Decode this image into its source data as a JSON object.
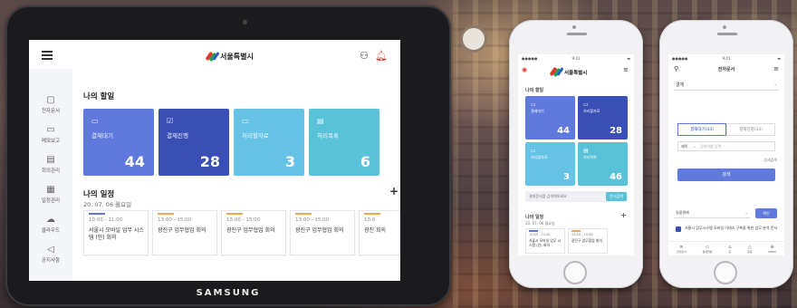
{
  "tablet": {
    "brand": "SAMSUNG",
    "logo_text": "서울특별시",
    "sidebar": [
      {
        "icon": "document-icon",
        "glyph": "▢",
        "label": "전자문서"
      },
      {
        "icon": "folder-icon",
        "glyph": "▭",
        "label": "메모보고"
      },
      {
        "icon": "list-icon",
        "glyph": "▤",
        "label": "회의관리"
      },
      {
        "icon": "calendar-icon",
        "glyph": "▦",
        "label": "일정관리"
      },
      {
        "icon": "cloud-icon",
        "glyph": "☁",
        "label": "클라우드"
      },
      {
        "icon": "megaphone-icon",
        "glyph": "◁",
        "label": "공지사항"
      }
    ],
    "tasks_title": "나의 할일",
    "cards": [
      {
        "label": "결재대기",
        "count": "44",
        "color": "#5f79dc"
      },
      {
        "label": "결재진행",
        "count": "28",
        "color": "#3a4fb6"
      },
      {
        "label": "처리할자료",
        "count": "3",
        "color": "#66c3e6"
      },
      {
        "label": "처리목록",
        "count": "6",
        "color": "#5ac2d8"
      }
    ],
    "schedule_title": "나의 일정",
    "schedule_date": "20. 07. 06 월요일",
    "schedule": [
      {
        "time": "10:00 - 11:00",
        "title": "서울시 모바일 업무 시스템 (안) 회의",
        "color": "#5f79dc"
      },
      {
        "time": "13:00 - 15:00",
        "title": "광진구 업무협업 회의",
        "color": "#f0a64a"
      },
      {
        "time": "13:00 - 15:00",
        "title": "광진구 업무협업 회의",
        "color": "#f0a64a"
      },
      {
        "time": "13:00 - 15:00",
        "title": "광진구 업무협업 회의",
        "color": "#f0a64a"
      },
      {
        "time": "13:0",
        "title": "광진 회의",
        "color": "#f0a64a"
      }
    ]
  },
  "phone1": {
    "logo_text": "서울특별시",
    "tasks_title": "나의 할일",
    "cards": [
      {
        "label": "결재대기",
        "count": "44",
        "color": "#5f79dc"
      },
      {
        "label": "처리할자료",
        "count": "28",
        "color": "#3a4fb6"
      },
      {
        "label": "처리할자료",
        "count": "3",
        "color": "#66c3e6"
      },
      {
        "label": "처리목록",
        "count": "46",
        "color": "#5ac2d8"
      }
    ],
    "search_placeholder": "결재문서를 검색해보세요",
    "search_button": "문서검색",
    "schedule_title": "나의 일정",
    "schedule_date": "20. 07. 06 월요일",
    "schedule": [
      {
        "time": "10:00 - 11:00",
        "title": "서울시 모바일 업무 시스템 (안) 회의"
      },
      {
        "time": "13:00 - 15:00",
        "title": "광진구 업무협업 회의"
      }
    ]
  },
  "phone2": {
    "title": "전자문서",
    "filter": "결재",
    "tab_active": "결재대기(43)",
    "tab_inactive": "결재진행(33)",
    "search_field_label": "제목",
    "search_field_placeholder": "검색어를 입력",
    "detail_search": "상세검색",
    "search_button": "검색",
    "sort_label": "일괄결재",
    "sort_button": "확인",
    "doc_title": "서울시 업무시스템 모바일 이데스 구축을 위한 업무 분석 문서",
    "nav": [
      "전자문서",
      "결재현황",
      "홈",
      "알림",
      "MENU"
    ]
  }
}
